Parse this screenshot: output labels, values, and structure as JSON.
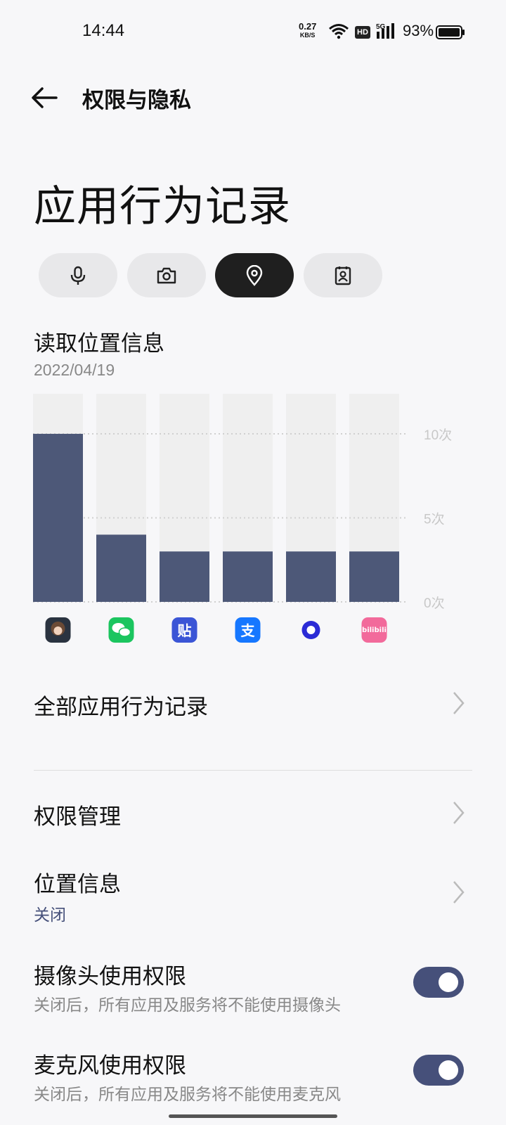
{
  "status_bar": {
    "time": "14:44",
    "net_speed": "0.27",
    "net_unit": "KB/S",
    "hd": "HD",
    "network": "5G",
    "battery": "93%"
  },
  "header": {
    "title": "权限与隐私"
  },
  "page": {
    "title": "应用行为记录"
  },
  "tabs": [
    {
      "name": "microphone",
      "icon": "microphone-icon",
      "active": false
    },
    {
      "name": "camera",
      "icon": "camera-icon",
      "active": false
    },
    {
      "name": "location",
      "icon": "location-pin-icon",
      "active": true
    },
    {
      "name": "contacts",
      "icon": "contacts-icon",
      "active": false
    }
  ],
  "section": {
    "title": "读取位置信息",
    "date": "2022/04/19"
  },
  "chart_data": {
    "type": "bar",
    "categories": [
      "game-app",
      "wechat",
      "tieba",
      "alipay",
      "circle-app",
      "bilibili"
    ],
    "values": [
      10,
      4,
      3,
      3,
      3,
      3
    ],
    "y_tick_labels": [
      "10次",
      "5次",
      "0次"
    ],
    "ylim": [
      0,
      10
    ],
    "grid": true,
    "colors": {
      "bar": "#4d5878",
      "track": "#efefef",
      "grid": "#d0d0d0"
    }
  },
  "app_icons": [
    {
      "name": "game-app-icon",
      "color": "#2a3340"
    },
    {
      "name": "wechat-icon",
      "color": "#1bc55f"
    },
    {
      "name": "tieba-icon",
      "color": "#3b55d6",
      "glyph": "贴"
    },
    {
      "name": "alipay-icon",
      "color": "#1677ff",
      "glyph": "支"
    },
    {
      "name": "circle-app-icon",
      "color": "#2b2bd6"
    },
    {
      "name": "bilibili-icon",
      "color": "#f26a9b",
      "glyph": "bilibili"
    }
  ],
  "rows": {
    "all_records": {
      "title": "全部应用行为记录"
    },
    "permission_mgmt": {
      "title": "权限管理"
    },
    "location": {
      "title": "位置信息",
      "sub": "关闭"
    },
    "camera": {
      "title": "摄像头使用权限",
      "sub": "关闭后，所有应用及服务将不能使用摄像头",
      "enabled": true
    },
    "microphone": {
      "title": "麦克风使用权限",
      "sub": "关闭后，所有应用及服务将不能使用麦克风",
      "enabled": true
    }
  }
}
